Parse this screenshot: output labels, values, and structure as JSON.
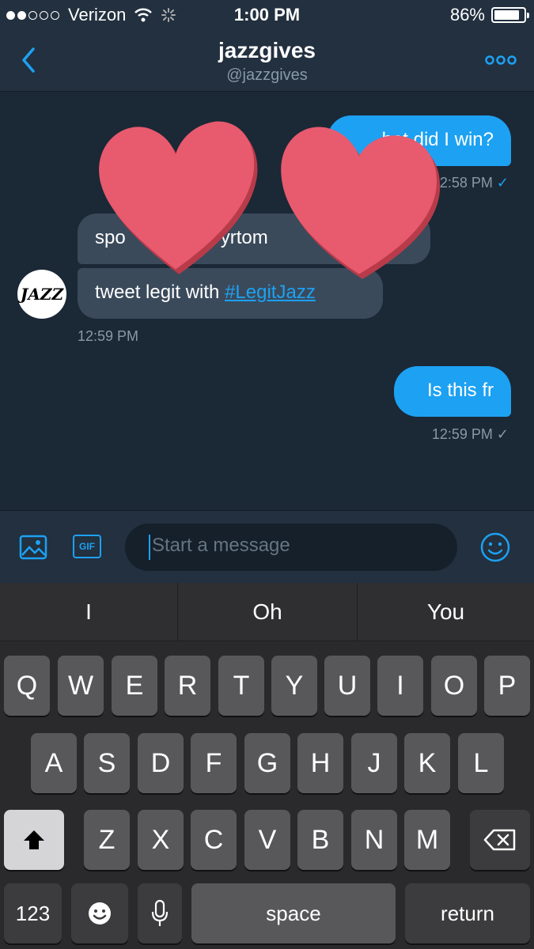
{
  "status_bar": {
    "carrier": "Verizon",
    "time": "1:00 PM",
    "battery": "86%",
    "battery_level": 0.86
  },
  "header": {
    "title": "jazzgives",
    "handle": "@jazzgives"
  },
  "messages": [
    {
      "text": "hat did I win?",
      "time": "2:58 PM",
      "status": "✓"
    },
    {
      "text_start": "spo",
      "text_end": "yrtom"
    },
    {
      "text": "tweet legit with ",
      "link": "#LegitJazz",
      "time": "12:59 PM"
    },
    {
      "text": "Is this fr",
      "time": "12:59 PM",
      "status": "✓"
    }
  ],
  "avatar": {
    "text": "JAZZ"
  },
  "compose": {
    "placeholder": "Start a message",
    "gif_label": "GIF"
  },
  "keyboard": {
    "predictions": [
      "I",
      "Oh",
      "You"
    ],
    "row1": [
      "Q",
      "W",
      "E",
      "R",
      "T",
      "Y",
      "U",
      "I",
      "O",
      "P"
    ],
    "row2": [
      "A",
      "S",
      "D",
      "F",
      "G",
      "H",
      "J",
      "K",
      "L"
    ],
    "row3": [
      "Z",
      "X",
      "C",
      "V",
      "B",
      "N",
      "M"
    ],
    "numbers_key": "123",
    "space_key": "space",
    "return_key": "return"
  },
  "colors": {
    "accent": "#1da1f2",
    "background": "#1b2836",
    "heart": "#e85a6e"
  }
}
